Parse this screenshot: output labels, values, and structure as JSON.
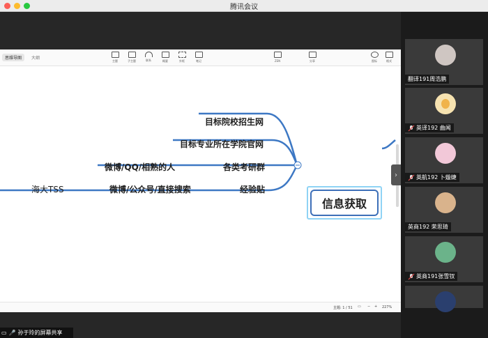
{
  "window": {
    "title": "腾讯会议"
  },
  "mindmap": {
    "tabs": {
      "active": "思维导图",
      "outline": "大纲"
    },
    "tools": [
      "主题",
      "子主题",
      "联系",
      "概要",
      "外框",
      "笔记",
      "ZEN",
      "分享",
      "图标",
      "格式"
    ],
    "root": "信息获取",
    "branches": [
      "目标院校招生网",
      "目标专业所在学院官网",
      "各类考研群",
      "经验贴"
    ],
    "children": {
      "group": "微博/QQ/相熟的人",
      "exp": "微博/公众号/直接搜索",
      "far": "海大TSS"
    },
    "status": {
      "topics": "主题: 1 / 51",
      "zoom": "227%"
    }
  },
  "participants": [
    {
      "name": "翻译191周浩鹏",
      "avatar_color": "#cfc6c2",
      "mic": false
    },
    {
      "name": "英译192 曲闻",
      "avatar_color": "#f0b34a",
      "mic": true
    },
    {
      "name": "英航192 卜嫙婕",
      "avatar_color": "#f2c8d8",
      "mic": true
    },
    {
      "name": "英商192 荣思琦",
      "avatar_color": "#d9b38c",
      "mic": false
    },
    {
      "name": "英商191张雪钗",
      "avatar_color": "#6bb38a",
      "mic": true
    }
  ],
  "share": {
    "label": "孙于玲的屏幕共享"
  }
}
